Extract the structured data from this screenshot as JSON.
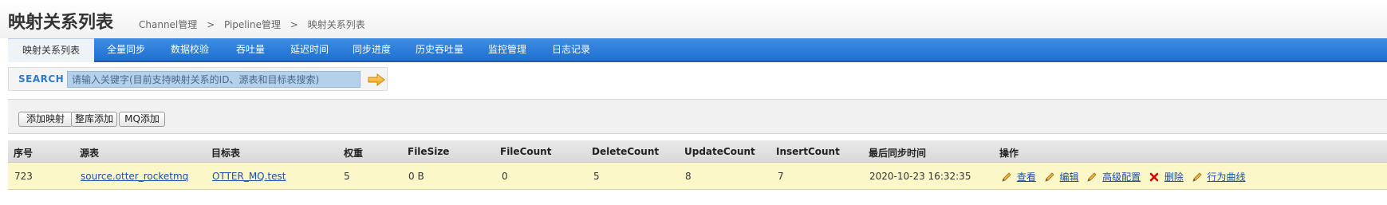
{
  "header": {
    "title": "映射关系列表",
    "breadcrumb": [
      "Channel管理",
      ">",
      "Pipeline管理",
      ">",
      "映射关系列表"
    ]
  },
  "nav": {
    "items": [
      {
        "label": "映射关系列表",
        "active": true
      },
      {
        "label": "全量同步"
      },
      {
        "label": "数据校验"
      },
      {
        "label": "吞吐量"
      },
      {
        "label": "延迟时间"
      },
      {
        "label": "同步进度"
      },
      {
        "label": "历史吞吐量"
      },
      {
        "label": "监控管理"
      },
      {
        "label": "日志记录"
      }
    ]
  },
  "search": {
    "label": "SEARCH",
    "placeholder": "请输入关键字(目前支持映射关系的ID、源表和目标表搜索)",
    "go_icon": "arrow-right-icon"
  },
  "toolbar": {
    "add_mapping": "添加映射",
    "add_db": "整库添加",
    "add_mq": "MQ添加"
  },
  "table": {
    "columns": [
      "序号",
      "源表",
      "目标表",
      "权重",
      "FileSize",
      "FileCount",
      "DeleteCount",
      "UpdateCount",
      "InsertCount",
      "最后同步时间",
      "操作"
    ],
    "rows": [
      {
        "id": "723",
        "source": "source.otter_rocketmq",
        "target": "OTTER_MQ.test",
        "weight": "5",
        "file_size": "0 B",
        "file_count": "0",
        "delete_count": "5",
        "update_count": "8",
        "insert_count": "7",
        "last_sync": "2020-10-23 16:32:35",
        "ops": {
          "view": "查看",
          "edit": "编辑",
          "advanced": "高级配置",
          "delete": "删除",
          "curve": "行为曲线"
        }
      }
    ]
  },
  "colors": {
    "nav_bg": "#1f6fd0",
    "row_highlight": "#fbf7c8",
    "link": "#1a4fb0",
    "delete_red": "#d40000"
  }
}
